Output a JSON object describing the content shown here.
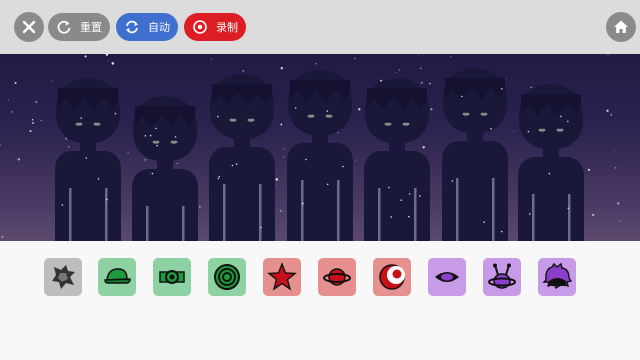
{
  "toolbar": {
    "close_icon": "close-icon",
    "reset_label": "重置",
    "auto_label": "自动",
    "record_label": "录制",
    "home_icon": "home-icon",
    "colors": {
      "bar": "#dcdcdc",
      "reset": "#8a8a8a",
      "auto": "#3f6fcf",
      "record": "#dc1e24"
    }
  },
  "stage": {
    "characters": [
      {
        "name": "character-1"
      },
      {
        "name": "character-2"
      },
      {
        "name": "character-3"
      },
      {
        "name": "character-4"
      },
      {
        "name": "character-5"
      },
      {
        "name": "character-6"
      },
      {
        "name": "character-7"
      }
    ]
  },
  "sounds": [
    {
      "name": "sound-shadow-splat-icon",
      "group": "gray"
    },
    {
      "name": "sound-green-cap-icon",
      "group": "green"
    },
    {
      "name": "sound-green-belt-icon",
      "group": "green"
    },
    {
      "name": "sound-green-rings-icon",
      "group": "green"
    },
    {
      "name": "sound-red-star-icon",
      "group": "red"
    },
    {
      "name": "sound-red-planet-icon",
      "group": "red"
    },
    {
      "name": "sound-red-crescent-icon",
      "group": "red"
    },
    {
      "name": "sound-purple-eye-icon",
      "group": "purple"
    },
    {
      "name": "sound-purple-antenna-icon",
      "group": "purple"
    },
    {
      "name": "sound-purple-hair-icon",
      "group": "purple"
    }
  ]
}
